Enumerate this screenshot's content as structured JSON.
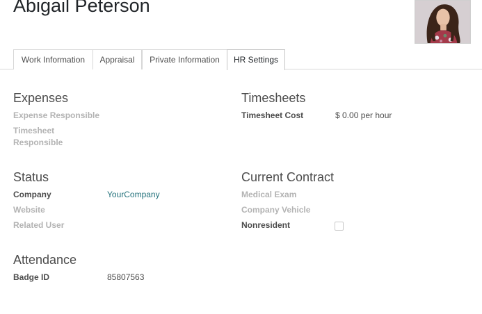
{
  "employee": {
    "name": "Abigail Peterson",
    "photo_icon": "employee-photo"
  },
  "tabs": [
    {
      "label": "Work Information"
    },
    {
      "label": "Appraisal"
    },
    {
      "label": "Private Information"
    },
    {
      "label": "HR Settings",
      "active": true
    }
  ],
  "expenses": {
    "title": "Expenses",
    "expense_responsible_label": "Expense Responsible",
    "timesheet_responsible_label_line1": "Timesheet",
    "timesheet_responsible_label_line2": "Responsible"
  },
  "timesheets": {
    "title": "Timesheets",
    "cost_label": "Timesheet Cost",
    "cost_value": "$ 0.00 per hour"
  },
  "status": {
    "title": "Status",
    "company_label": "Company",
    "company_value": "YourCompany",
    "website_label": "Website",
    "related_user_label": "Related User"
  },
  "contract": {
    "title": "Current Contract",
    "medical_exam_label": "Medical Exam",
    "company_vehicle_label": "Company Vehicle",
    "nonresident_label": "Nonresident",
    "nonresident_checked": false
  },
  "attendance": {
    "title": "Attendance",
    "badge_label": "Badge ID",
    "badge_value": "85807563"
  },
  "colors": {
    "link": "#21707a",
    "label_optional": "#b3b3b3",
    "label_required": "#4c4c4c"
  }
}
